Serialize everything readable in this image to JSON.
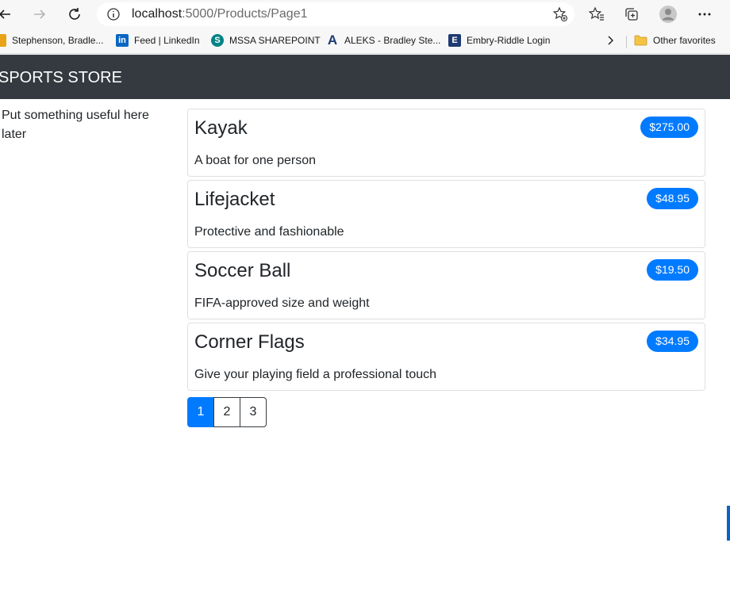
{
  "browser": {
    "url_host": "localhost",
    "url_path": ":5000/Products/Page1",
    "favorites": [
      {
        "label": "Stephenson, Bradle...",
        "icon": "profile-icon",
        "color": "#e8a317"
      },
      {
        "label": "Feed | LinkedIn",
        "icon": "linkedin-icon",
        "color": "#0a66c2"
      },
      {
        "label": "MSSA SHAREPOINT",
        "icon": "sharepoint-icon",
        "color": "#038387"
      },
      {
        "label": "ALEKS - Bradley Ste...",
        "icon": "aleks-icon",
        "color": "#1f3b73"
      },
      {
        "label": "Embry-Riddle Login",
        "icon": "embry-riddle-icon",
        "color": "#1f3b73"
      }
    ],
    "other_favorites": "Other favorites"
  },
  "header": {
    "brand": "SPORTS STORE"
  },
  "sidebar": {
    "text": "Put something useful here later"
  },
  "products": [
    {
      "name": "Kayak",
      "description": "A boat for one person",
      "price": "$275.00"
    },
    {
      "name": "Lifejacket",
      "description": "Protective and fashionable",
      "price": "$48.95"
    },
    {
      "name": "Soccer Ball",
      "description": "FIFA-approved size and weight",
      "price": "$19.50"
    },
    {
      "name": "Corner Flags",
      "description": "Give your playing field a professional touch",
      "price": "$34.95"
    }
  ],
  "pagination": {
    "pages": [
      "1",
      "2",
      "3"
    ],
    "current": "1"
  },
  "colors": {
    "accent": "#007bff",
    "navbar": "#343a40"
  }
}
